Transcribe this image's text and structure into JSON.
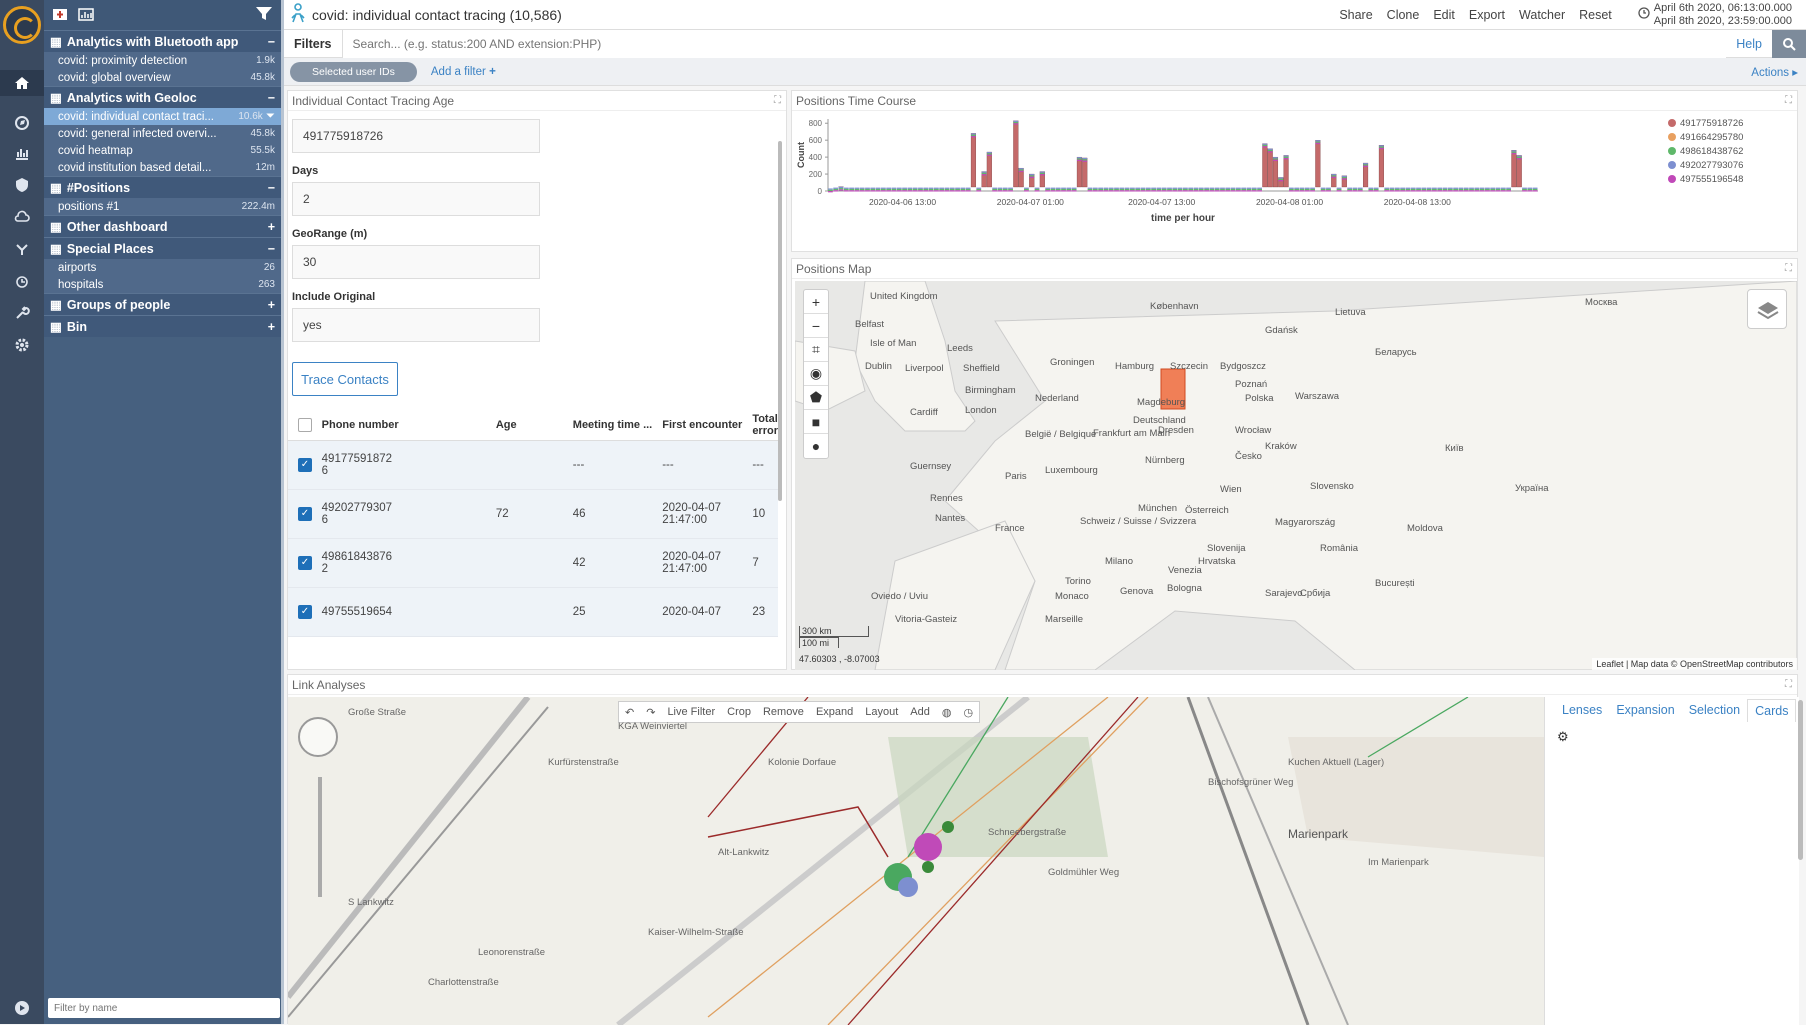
{
  "app": {
    "title": "covid: individual contact tracing (10,586)"
  },
  "topbar": {
    "actions": [
      "Share",
      "Clone",
      "Edit",
      "Export",
      "Watcher",
      "Reset"
    ],
    "time_from": "April 6th 2020, 06:13:00.000",
    "time_to": "April 8th 2020, 23:59:00.000"
  },
  "filters": {
    "label": "Filters",
    "search_placeholder": "Search... (e.g. status:200 AND extension:PHP)",
    "help": "Help",
    "pill": "Selected user IDs",
    "add": "Add a filter",
    "actions": "Actions"
  },
  "sidebar": {
    "filter_placeholder": "Filter by name",
    "sections": [
      {
        "name": "Analytics with Bluetooth app",
        "toggle": "−",
        "items": [
          {
            "name": "covid: proximity detection",
            "count": "1.9k"
          },
          {
            "name": "covid: global overview",
            "count": "45.8k"
          }
        ]
      },
      {
        "name": "Analytics with Geoloc",
        "toggle": "−",
        "items": [
          {
            "name": "covid: individual contact traci...",
            "count": "10.6k",
            "selected": true
          },
          {
            "name": "covid: general infected overvi...",
            "count": "45.8k"
          },
          {
            "name": "covid heatmap",
            "count": "55.5k"
          },
          {
            "name": "covid institution based detail...",
            "count": "12m"
          }
        ]
      },
      {
        "name": "#Positions",
        "toggle": "−",
        "items": [
          {
            "name": "positions #1",
            "count": "222.4m"
          }
        ]
      },
      {
        "name": "Other dashboard",
        "toggle": "+",
        "items": []
      },
      {
        "name": "Special Places",
        "toggle": "−",
        "items": [
          {
            "name": "airports",
            "count": "26"
          },
          {
            "name": "hospitals",
            "count": "263"
          }
        ]
      },
      {
        "name": "Groups of people",
        "toggle": "+",
        "items": []
      },
      {
        "name": "Bin",
        "toggle": "+",
        "items": []
      }
    ]
  },
  "form": {
    "title": "Individual Contact Tracing Age",
    "phone_value": "491775918726",
    "days_label": "Days",
    "days_value": "2",
    "geo_label": "GeoRange (m)",
    "geo_value": "30",
    "orig_label": "Include Original",
    "orig_value": "yes",
    "trace_button": "Trace Contacts",
    "columns": [
      "Phone number",
      "Age",
      "Meeting time ...",
      "First encounter",
      "Total error"
    ],
    "rows": [
      {
        "phone": "49177591872",
        "phone2": "6",
        "age": "",
        "meeting": "---",
        "first": "---",
        "first2": "",
        "error": "---"
      },
      {
        "phone": "49202779307",
        "phone2": "6",
        "age": "72",
        "meeting": "46",
        "first": "2020-04-07",
        "first2": "21:47:00",
        "error": "10"
      },
      {
        "phone": "49861843876",
        "phone2": "2",
        "age": "",
        "meeting": "42",
        "first": "2020-04-07",
        "first2": "21:47:00",
        "error": "7"
      },
      {
        "phone": "49755519654",
        "phone2": "",
        "age": "",
        "meeting": "25",
        "first": "2020-04-07",
        "first2": "",
        "error": "23"
      }
    ]
  },
  "timecourse": {
    "title": "Positions Time Course",
    "xlabel": "time per hour",
    "ylabel": "Count",
    "xticks": [
      "2020-04-06 13:00",
      "2020-04-07 01:00",
      "2020-04-07 13:00",
      "2020-04-08 01:00",
      "2020-04-08 13:00"
    ],
    "yticks": [
      "800",
      "600",
      "400",
      "200",
      "0"
    ]
  },
  "chart_data": {
    "type": "bar",
    "title": "Positions Time Course",
    "xlabel": "time per hour",
    "ylabel": "Count",
    "ylim": [
      0,
      850
    ],
    "stacked": true,
    "legend": [
      "491775918726",
      "491664295780",
      "498618438762",
      "492027793076",
      "497555196548"
    ],
    "colors": [
      "#c46a6a",
      "#e8a060",
      "#5fb86a",
      "#7d8fd0",
      "#c048b8"
    ],
    "values": [
      30,
      40,
      50,
      40,
      40,
      40,
      40,
      40,
      40,
      40,
      40,
      40,
      40,
      40,
      40,
      40,
      40,
      40,
      40,
      40,
      40,
      40,
      40,
      40,
      40,
      40,
      40,
      680,
      40,
      230,
      460,
      40,
      40,
      40,
      40,
      830,
      270,
      40,
      200,
      40,
      230,
      40,
      40,
      40,
      40,
      40,
      40,
      400,
      390,
      40,
      40,
      40,
      40,
      40,
      40,
      40,
      40,
      40,
      40,
      40,
      40,
      40,
      40,
      40,
      40,
      40,
      40,
      40,
      40,
      40,
      40,
      40,
      40,
      40,
      40,
      40,
      40,
      40,
      40,
      40,
      40,
      40,
      560,
      500,
      400,
      160,
      420,
      40,
      40,
      40,
      40,
      40,
      600,
      40,
      40,
      200,
      40,
      180,
      40,
      40,
      40,
      330,
      40,
      40,
      540,
      40,
      40,
      40,
      40,
      40,
      40,
      40,
      40,
      40,
      40,
      40,
      40,
      40,
      40,
      40,
      40,
      40,
      40,
      40,
      40,
      40,
      40,
      40,
      40,
      480,
      420,
      40,
      40,
      40
    ]
  },
  "map": {
    "title": "Positions Map",
    "attrib": "Leaflet | Map data © OpenStreetMap contributors",
    "scale_km": "300 km",
    "scale_mi": "100 mi",
    "coords": "47.60303 , -8.07003",
    "labels": [
      "United Kingdom",
      "Belfast",
      "Isle of Man",
      "Leeds",
      "Dublin",
      "Liverpool",
      "Sheffield",
      "Birmingham",
      "London",
      "Cardiff",
      "Guernsey",
      "Rennes",
      "Nantes",
      "France",
      "Paris",
      "Luxembourg",
      "Nederland",
      "Groningen",
      "Hamburg",
      "København",
      "Deutschland",
      "Magdeburg",
      "Dresden",
      "Frankfurt am Main",
      "Nürnberg",
      "München",
      "België / Belgique",
      "Szczecin",
      "Bydgoszcz",
      "Gdańsk",
      "Polska",
      "Poznań",
      "Warszawa",
      "Wrocław",
      "Kraków",
      "Lietuva",
      "Беларусь",
      "Москва",
      "Україна",
      "Київ",
      "Česko",
      "Wien",
      "Österreich",
      "Slovensko",
      "Magyarország",
      "Schweiz / Suisse / Svizzera",
      "Milano",
      "Torino",
      "Monaco",
      "Genova",
      "Bologna",
      "Venezia",
      "Slovenija",
      "Hrvatska",
      "România",
      "Moldova",
      "București",
      "Србија",
      "Sarajevo",
      "Marseille",
      "Vitoria-Gasteiz",
      "Oviedo / Uviu"
    ]
  },
  "link": {
    "title": "Link Analyses",
    "toolbar": [
      "Live Filter",
      "Crop",
      "Remove",
      "Expand",
      "Layout",
      "Add"
    ],
    "tabs": [
      "Lenses",
      "Expansion",
      "Selection",
      "Cards"
    ],
    "streets": [
      "Große Straße",
      "Kaiser-Wilhelm-Straße",
      "KGA Weinviertel",
      "Kolonie Dorfaue",
      "Alt-Lankwitz",
      "Schneebergstraße",
      "Kurfürstenstraße",
      "Marienpark",
      "Kuchen Aktuell (Lager)",
      "Bischofsgrüner Weg",
      "Im Marienpark",
      "S Lankwitz",
      "Charlottenstraße",
      "Leonorenstraße",
      "Goldmühler Weg"
    ]
  }
}
